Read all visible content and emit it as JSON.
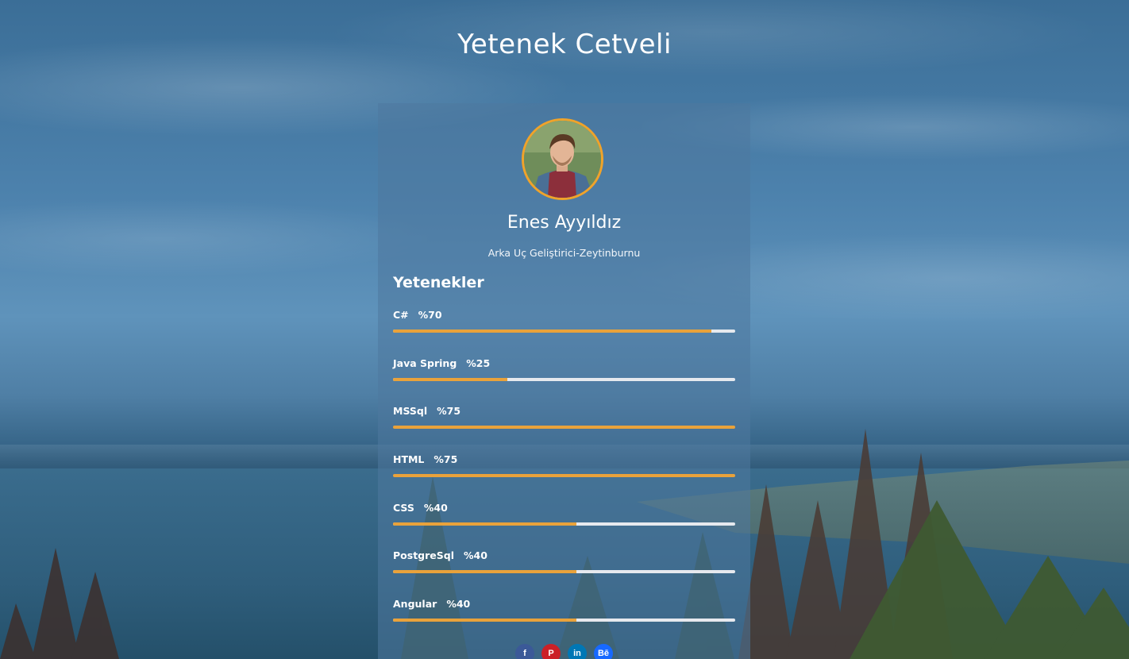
{
  "page": {
    "title": "Yetenek Cetveli"
  },
  "profile": {
    "name": "Enes Ayyıldız",
    "role": "Arka Uç Geliştirici-Zeytinburnu",
    "avatar_icon": "person-photo"
  },
  "skills_section": {
    "title": "Yetenekler",
    "items": [
      {
        "name": "C#",
        "percent_text": "%70",
        "fill": 0.93
      },
      {
        "name": "Java Spring",
        "percent_text": "%25",
        "fill": 0.335
      },
      {
        "name": "MSSql",
        "percent_text": "%75",
        "fill": 1.0
      },
      {
        "name": "HTML",
        "percent_text": "%75",
        "fill": 1.0
      },
      {
        "name": "CSS",
        "percent_text": "%40",
        "fill": 0.535
      },
      {
        "name": "PostgreSql",
        "percent_text": "%40",
        "fill": 0.535
      },
      {
        "name": "Angular",
        "percent_text": "%40",
        "fill": 0.535
      }
    ]
  },
  "social": [
    {
      "icon": "facebook-icon",
      "glyph": "f",
      "color": "#3b5998"
    },
    {
      "icon": "pinterest-icon",
      "glyph": "P",
      "color": "#cb2027"
    },
    {
      "icon": "linkedin-icon",
      "glyph": "in",
      "color": "#0077b5"
    },
    {
      "icon": "behance-icon",
      "glyph": "Bē",
      "color": "#1769ff"
    }
  ],
  "colors": {
    "accent": "#e9a23b",
    "track": "#e6e9ee"
  }
}
